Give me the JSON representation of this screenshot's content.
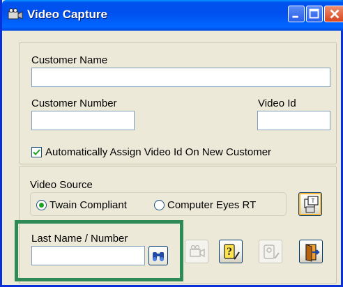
{
  "window": {
    "title": "Video Capture",
    "icon": "camera-icon",
    "controls": [
      "minimize-icon",
      "maximize-icon",
      "close-icon"
    ]
  },
  "customer": {
    "name_label": "Customer Name",
    "name_value": "",
    "number_label": "Customer Number",
    "number_value": "",
    "video_id_label": "Video Id",
    "video_id_value": "",
    "auto_assign_label": "Automatically Assign Video Id On New Customer",
    "auto_assign_checked": true
  },
  "video_source": {
    "label": "Video Source",
    "options": [
      {
        "label": "Twain Compliant",
        "selected": true
      },
      {
        "label": "Computer Eyes RT",
        "selected": false
      }
    ]
  },
  "search": {
    "label": "Last Name / Number",
    "value": "",
    "button_icon": "binoculars-icon"
  },
  "toolbar": {
    "source_settings_icon": "video-source-settings-icon",
    "capture_icon": "camera-capture-icon",
    "help_icon": "help-icon",
    "security_icon": "security-icon",
    "exit_icon": "exit-door-icon"
  },
  "colors": {
    "title_bar": "#0058e6",
    "window_bg": "#ece9d8",
    "highlight": "#2e8b57",
    "radio_selected": "#21a121"
  }
}
